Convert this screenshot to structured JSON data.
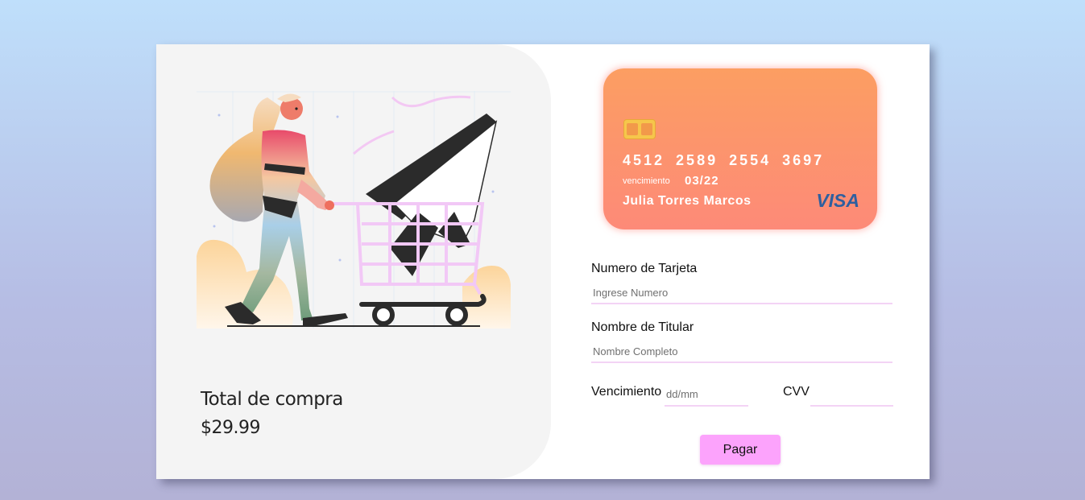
{
  "summary": {
    "total_label": "Total de compra",
    "total_amount": "$29.99"
  },
  "card": {
    "number": "4512 2589 2554 3697",
    "expiry_label": "vencimiento",
    "expiry": "03/22",
    "holder": "Julia Torres Marcos",
    "brand": "VISA"
  },
  "form": {
    "card_number_label": "Numero de Tarjeta",
    "card_number_placeholder": "Ingrese Numero",
    "holder_label": "Nombre de Titular",
    "holder_placeholder": "Nombre Completo",
    "expiry_label": "Vencimiento",
    "expiry_placeholder": "dd/mm",
    "cvv_label": "CVV",
    "cvv_placeholder": "",
    "pay_label": "Pagar"
  },
  "colors": {
    "card_gradient_top": "#fc9e62",
    "card_gradient_bottom": "#fd8a78",
    "pay_button": "#fca3fc",
    "input_underline": "#f3d3f5"
  },
  "icons": [
    "shopping-cart-illustration",
    "card-chip-icon",
    "visa-logo"
  ]
}
